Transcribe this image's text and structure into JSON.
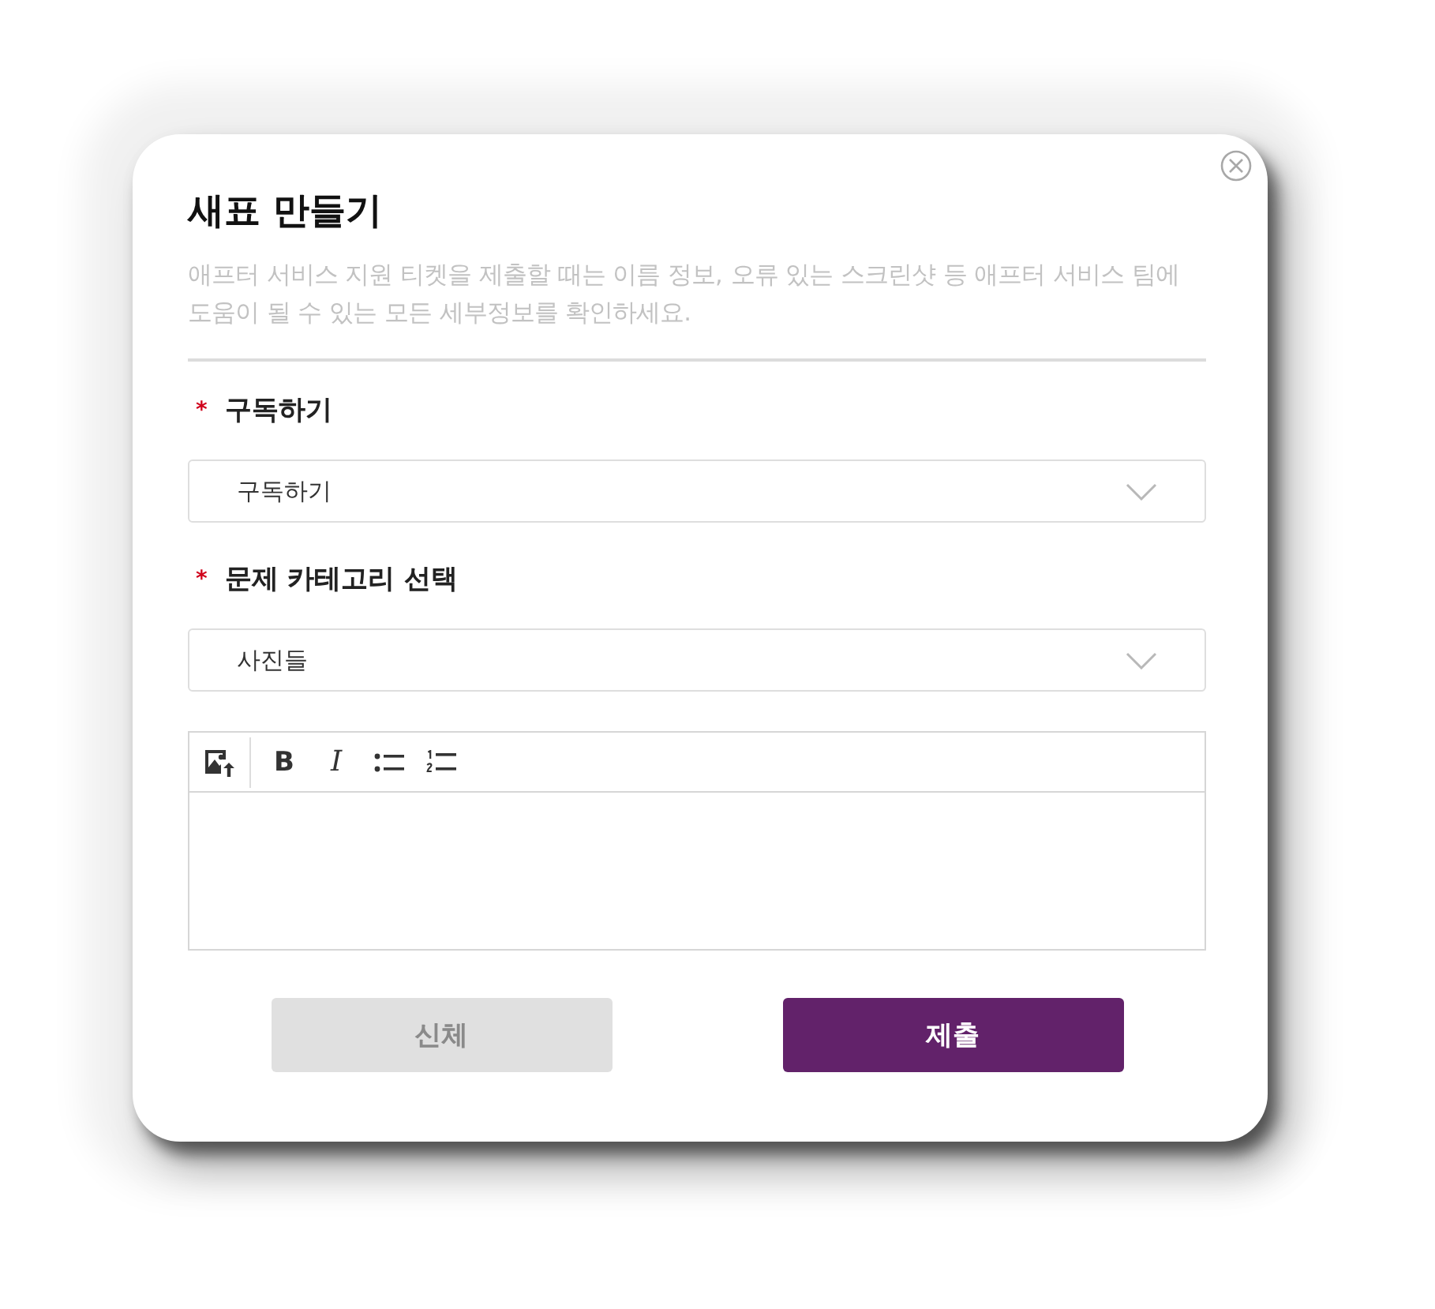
{
  "dialog": {
    "title": "새표 만들기",
    "description": "애프터 서비스 지원 티켓을 제출할 때는 이름 정보, 오류 있는 스크린샷 등 애프터 서비스 팀에 도움이 될 수 있는 모든 세부정보를 확인하세요."
  },
  "fields": [
    {
      "required_mark": "*",
      "label": "구독하기",
      "value": "구독하기"
    },
    {
      "required_mark": "*",
      "label": "문제 카테고리 선택",
      "value": "사진들"
    }
  ],
  "editor": {
    "toolbar": [
      [
        {
          "kind": "image"
        }
      ],
      [
        {
          "kind": "bold",
          "label": "B"
        },
        {
          "kind": "italic",
          "label": "I"
        },
        {
          "kind": "bullets"
        },
        {
          "kind": "numbers"
        }
      ]
    ]
  },
  "buttons": [
    {
      "kind": "secondary",
      "label": "신체"
    },
    {
      "kind": "primary",
      "label": "제출"
    }
  ]
}
